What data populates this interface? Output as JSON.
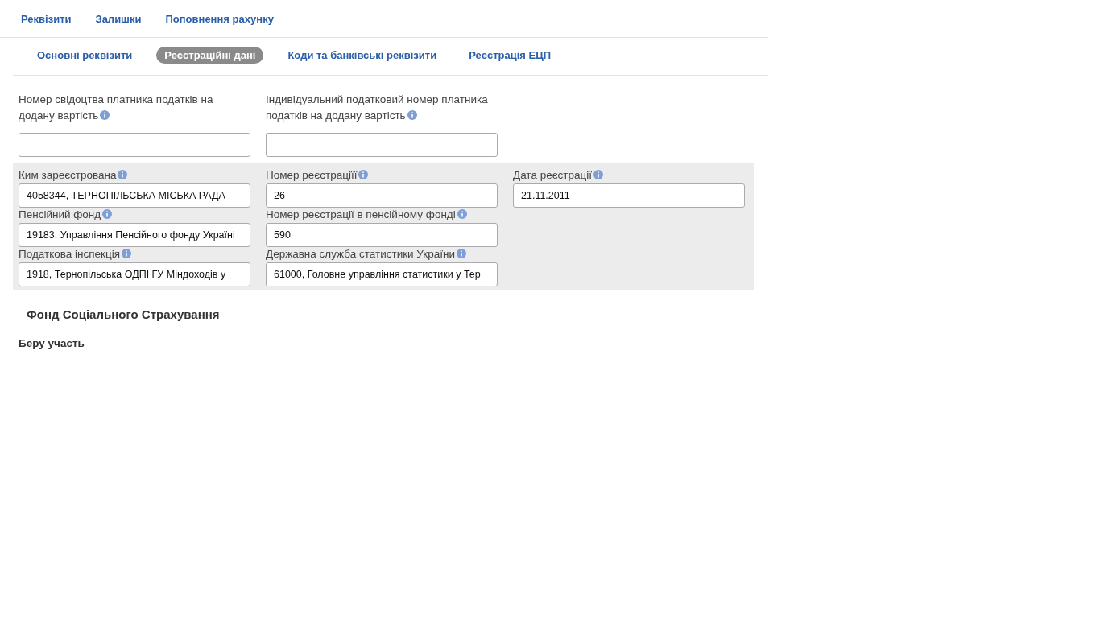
{
  "top_nav": [
    "Реквізити",
    "Залишки",
    "Поповнення рахунку"
  ],
  "sub_tabs": [
    {
      "label": "Основні реквізити",
      "selected": false
    },
    {
      "label": "Реєстраційні дані",
      "selected": true
    },
    {
      "label": "Коди та банківські реквізити",
      "selected": false
    },
    {
      "label": "Реєстрація ЕЦП",
      "selected": false
    }
  ],
  "vat_fields": [
    {
      "label": "Номер свідоцтва платника податків на додану вартість"
    },
    {
      "label": "Індивідуальний податковий номер платника податків на додану вартість"
    }
  ],
  "registration_fields": [
    {
      "label": "Ким зареєстрована",
      "value": "4058344, ТЕРНОПІЛЬСЬКА МІСЬКА РАДА"
    },
    {
      "label": "Номер реєстраціїї",
      "value": "26"
    },
    {
      "label": "Дата реєстрації",
      "value": "21.11.2011"
    },
    {
      "label": "Пенсійний фонд",
      "value": "19183, Управління Пенсійного фонду Україні"
    },
    {
      "label": "Номер реєстрації в пенсійному фонді",
      "value": "590"
    },
    {
      "label": "Податкова інспекція",
      "value": "1918, Тернопільська ОДПІ ГУ Міндоходів у"
    },
    {
      "label": "Державна служба статистики України",
      "value": "61000, Головне управління статистики у Тер"
    }
  ],
  "social_fund": {
    "title": "Фонд Соціального Страхування",
    "status": "Беру участь"
  }
}
